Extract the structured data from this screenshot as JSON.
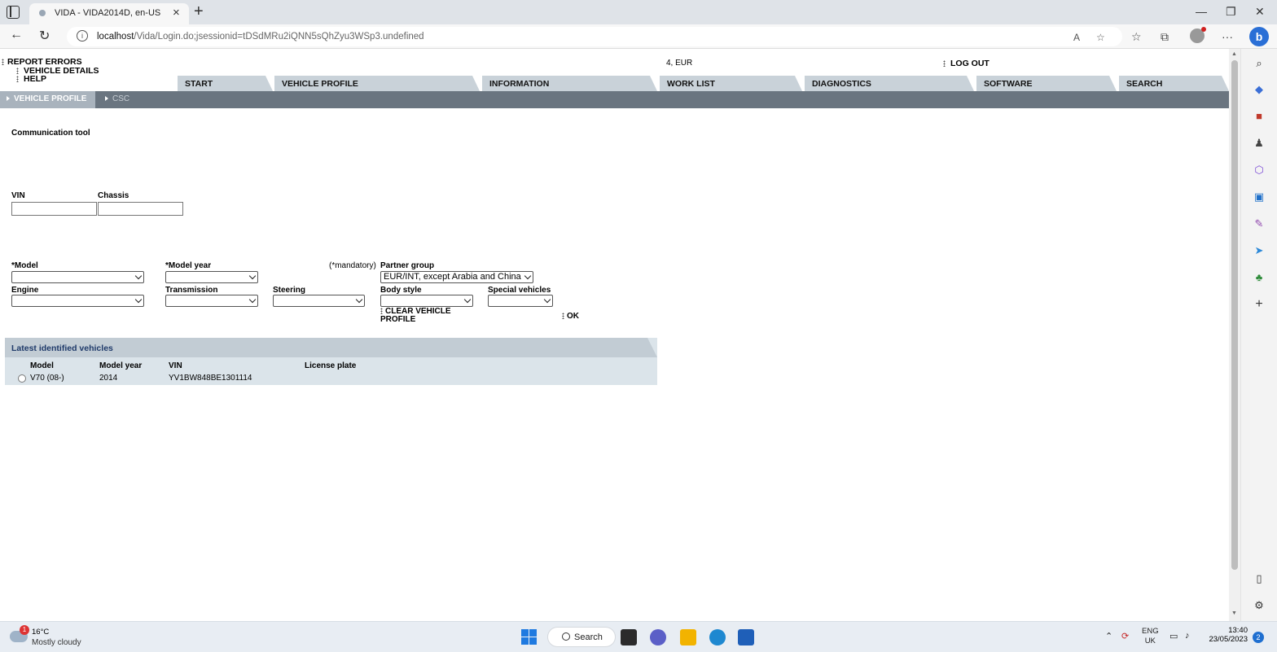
{
  "browser": {
    "tab_title": "VIDA - VIDA2014D, en-US",
    "url_host": "localhost",
    "url_path": "/Vida/Login.do;jsessionid=tDSdMRu2iQNN5sQhZyu3WSp3.undefined"
  },
  "header": {
    "report_errors": "REPORT ERRORS",
    "vehicle_details": "VEHICLE DETAILS",
    "help": "HELP",
    "region": "4, EUR",
    "log_out": "LOG OUT"
  },
  "main_tabs": [
    "START",
    "VEHICLE PROFILE",
    "INFORMATION",
    "WORK LIST",
    "DIAGNOSTICS",
    "SOFTWARE",
    "SEARCH"
  ],
  "sub_tabs": {
    "active": "VEHICLE PROFILE",
    "other": "CSC"
  },
  "form": {
    "section_title": "Communication tool",
    "vin_label": "VIN",
    "chassis_label": "Chassis",
    "model_label": "*Model",
    "model_year_label": "*Model year",
    "mandatory_note": "(*mandatory)",
    "partner_group_label": "Partner group",
    "partner_group_value": "EUR/INT, except Arabia and China",
    "engine_label": "Engine",
    "transmission_label": "Transmission",
    "steering_label": "Steering",
    "body_style_label": "Body style",
    "special_vehicles_label": "Special vehicles",
    "clear_line1": "CLEAR VEHICLE",
    "clear_line2": "PROFILE",
    "ok": "OK"
  },
  "latest": {
    "title": "Latest identified vehicles",
    "columns": [
      "Model",
      "Model year",
      "VIN",
      "License plate"
    ],
    "rows": [
      {
        "model": "V70 (08-)",
        "model_year": "2014",
        "vin": "YV1BW848BE1301114",
        "license_plate": ""
      }
    ]
  },
  "taskbar": {
    "weather_badge": "1",
    "temp": "16°C",
    "weather_desc": "Mostly cloudy",
    "search": "Search",
    "lang_line1": "ENG",
    "lang_line2": "UK",
    "time": "13:40",
    "date": "23/05/2023",
    "notifications": "2"
  }
}
